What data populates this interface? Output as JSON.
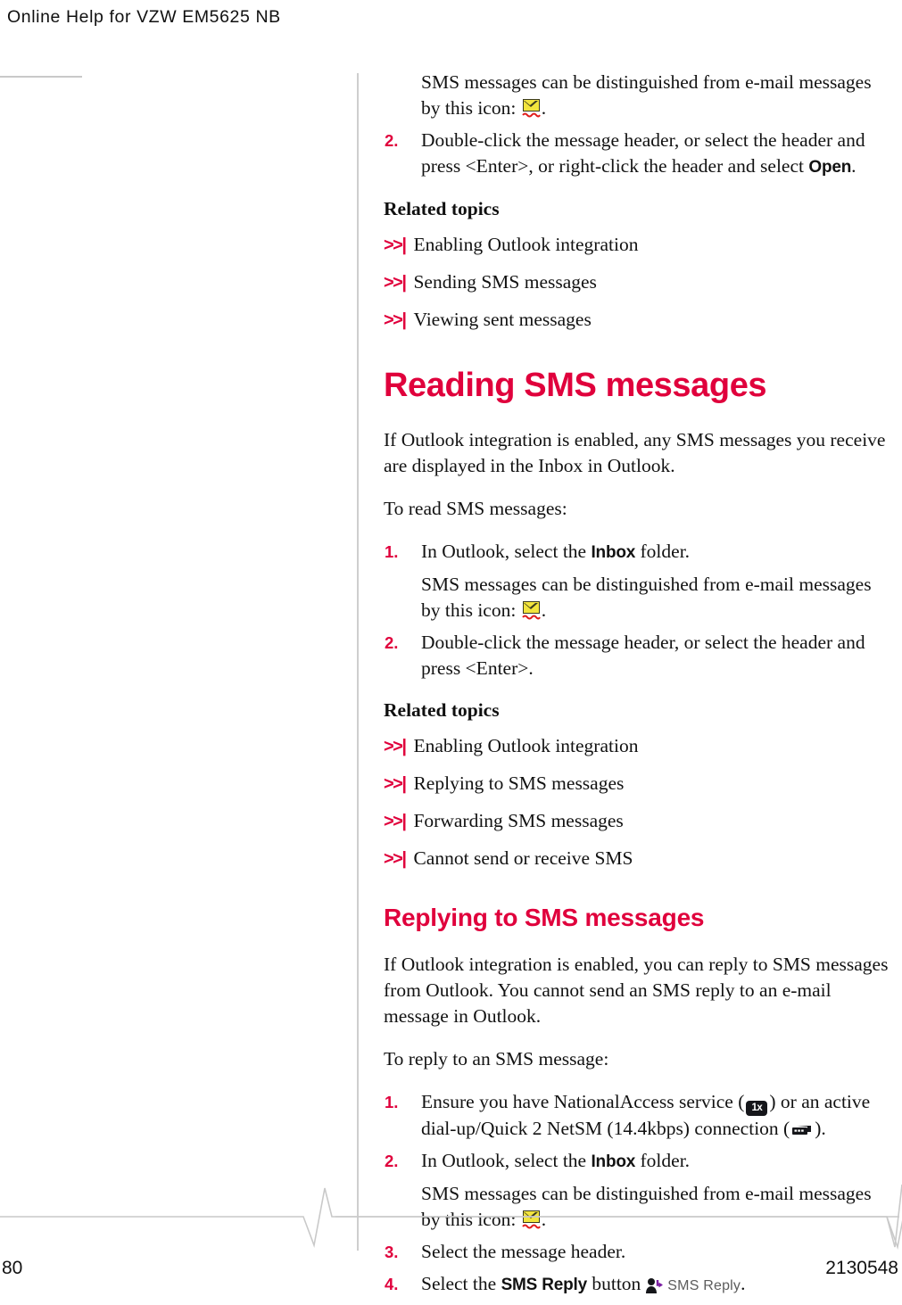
{
  "header": {
    "running_title": "Online Help for VZW EM5625 NB"
  },
  "colors": {
    "accent": "#e0003c",
    "body_text": "#121212",
    "rule": "#c9c9c9"
  },
  "continued_section": {
    "step1_continuation": "SMS messages can be distinguished from e-mail messages by this icon:",
    "step2_num": "2.",
    "step2_text_a": "Double-click the message header, or select the header and press <Enter>, or right-click the header and select ",
    "step2_ui_open": "Open",
    "step2_text_b": ".",
    "related_heading": "Related topics",
    "related_links": [
      {
        "marker": ">>|",
        "label": "Enabling Outlook integration"
      },
      {
        "marker": ">>|",
        "label": "Sending SMS messages"
      },
      {
        "marker": ">>|",
        "label": "Viewing sent messages"
      }
    ]
  },
  "reading_section": {
    "title": "Reading SMS messages",
    "intro": "If Outlook integration is enabled, any SMS messages you receive are displayed in the Inbox in Outlook.",
    "lead_in": "To read SMS messages:",
    "step1_num": "1.",
    "step1_text_a": "In Outlook, select the ",
    "step1_ui_inbox": "Inbox",
    "step1_text_b": " folder.",
    "step1_continuation": "SMS messages can be distinguished from e-mail messages by this icon:",
    "step2_num": "2.",
    "step2_text": "Double-click the message header, or select the header and press <Enter>.",
    "related_heading": "Related topics",
    "related_links": [
      {
        "marker": ">>|",
        "label": "Enabling Outlook integration"
      },
      {
        "marker": ">>|",
        "label": "Replying to SMS messages"
      },
      {
        "marker": ">>|",
        "label": "Forwarding SMS messages"
      },
      {
        "marker": ">>|",
        "label": "Cannot send or receive SMS"
      }
    ]
  },
  "replying_section": {
    "title": "Replying to SMS messages",
    "intro": "If Outlook integration is enabled, you can reply to SMS messages from Outlook. You cannot send an SMS reply to an e-mail message in Outlook.",
    "lead_in": "To reply to an SMS message:",
    "step1_num": "1.",
    "step1_text_a": "Ensure you have NationalAccess service (",
    "step1_icon_1x_label": "1x",
    "step1_text_b": ") or an active dial-up/Quick 2 NetSM (14.4kbps) connection (",
    "step1_text_c": ").",
    "step2_num": "2.",
    "step2_text_a": "In Outlook, select the ",
    "step2_ui_inbox": "Inbox",
    "step2_text_b": " folder.",
    "step2_continuation": "SMS messages can be distinguished from e-mail messages by this icon:",
    "step3_num": "3.",
    "step3_text": "Select the message header.",
    "step4_num": "4.",
    "step4_text_a": "Select the ",
    "step4_ui_button": "SMS Reply",
    "step4_text_b": " button",
    "step4_button_graphic_label": "SMS Reply",
    "step4_text_c": "."
  },
  "footer": {
    "page_number": "80",
    "document_number": "2130548"
  }
}
